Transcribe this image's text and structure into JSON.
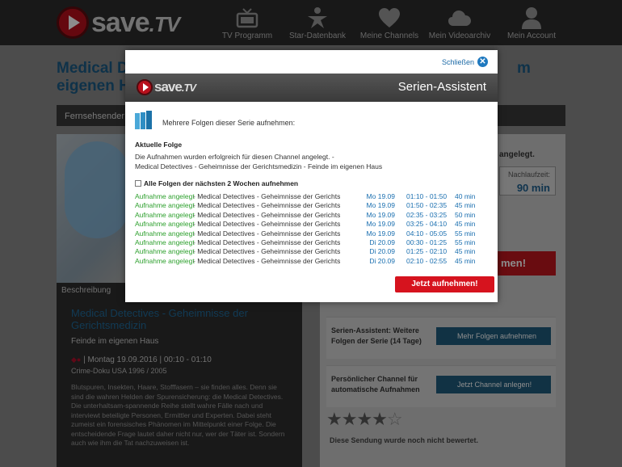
{
  "nav": {
    "logo_text": "save",
    "logo_suffix": ".TV",
    "items": [
      {
        "label": "TV Programm",
        "icon": "tv-icon"
      },
      {
        "label": "Star-Datenbank",
        "icon": "star-person-icon"
      },
      {
        "label": "Meine Channels",
        "icon": "heart-icon"
      },
      {
        "label": "Mein Videoarchiv",
        "icon": "cloud-icon"
      },
      {
        "label": "Mein Account",
        "icon": "user-icon"
      }
    ]
  },
  "background": {
    "title_line1": "Medical D",
    "title_line1_end": "m",
    "title_line2": "eigenen H",
    "sender_select": "Fernsehsender",
    "desc_tab": "Beschreibung",
    "desc_title": "Medical Detectives - Geheimnisse der Gerichtsmedizin",
    "desc_subtitle": "Feinde im eigenen Haus",
    "desc_meta": "| Montag 19.09.2016 | 00:10 - 01:10",
    "desc_genre": "Crime-Doku USA 1996 / 2005",
    "desc_text": "Blutspuren, Insekten, Haare, Stofffasern – sie finden alles. Denn sie sind die wahren Helden der Spurensicherung: die Medical Detectives. Die unterhaltsam-spannende Reihe stellt wahre Fälle nach und interviewt beteiligte Personen, Ermittler und Experten. Dabei steht zumeist ein forensisches Phänomen im Mittelpunkt einer Folge. Die entscheidende Frage lautet daher nicht nur, wer der Täter ist. Sondern auch wie ihm die Tat nachzuweisen ist.",
    "angelegt": "angelegt.",
    "nachlaufzeit_label": "Nachlaufzeit:",
    "nachlaufzeit_value": "90 min",
    "red_button_partial": "men!",
    "serien_text": "Serien-Assistent: Weitere Folgen der Serie (14 Tage)",
    "serien_button": "Mehr Folgen aufnehmen",
    "channel_text": "Persönlicher Channel für automatische Aufnahmen",
    "channel_button": "Jetzt Channel anlegen!",
    "stars_filled": "★★★★",
    "stars_empty": "☆",
    "not_rated": "Diese Sendung wurde noch nicht bewertet."
  },
  "modal": {
    "close_label": "Schließen",
    "header_logo": "save",
    "header_logo_suffix": ".TV",
    "title": "Serien-Assistent",
    "intro": "Mehrere Folgen dieser Serie aufnehmen:",
    "current_heading": "Aktuelle Folge",
    "current_msg_line1": "Die Aufnahmen wurden erfolgreich für diesen Channel angelegt. -",
    "current_msg_line2": "Medical Detectives - Geheimnisse der Gerichtsmedizin - Feinde im eigenen Haus",
    "all_checkbox_label": "Alle Folgen der nächsten 2 Wochen aufnehmen",
    "submit_label": "Jetzt aufnehmen!",
    "colors": {
      "status_green": "#2ea02e",
      "link_blue": "#1a6fb0",
      "button_red": "#d6131e"
    },
    "episodes": [
      {
        "status": "Aufnahme angelegt",
        "title": "- Medical Detectives - Geheimnisse der Gerichts...",
        "date": "Mo 19.09",
        "time": "01:10 - 01:50",
        "duration": "40 min"
      },
      {
        "status": "Aufnahme angelegt",
        "title": "- Medical Detectives - Geheimnisse der Gerichts...",
        "date": "Mo 19.09",
        "time": "01:50 - 02:35",
        "duration": "45 min"
      },
      {
        "status": "Aufnahme angelegt",
        "title": "- Medical Detectives - Geheimnisse der Gerichts...",
        "date": "Mo 19.09",
        "time": "02:35 - 03:25",
        "duration": "50 min"
      },
      {
        "status": "Aufnahme angelegt",
        "title": "- Medical Detectives - Geheimnisse der Gerichts...",
        "date": "Mo 19.09",
        "time": "03:25 - 04:10",
        "duration": "45 min"
      },
      {
        "status": "Aufnahme angelegt",
        "title": "- Medical Detectives - Geheimnisse der Gerichts...",
        "date": "Mo 19.09",
        "time": "04:10 - 05:05",
        "duration": "55 min"
      },
      {
        "status": "Aufnahme angelegt",
        "title": "- Medical Detectives - Geheimnisse der Gerichts...",
        "date": "Di 20.09",
        "time": "00:30 - 01:25",
        "duration": "55 min"
      },
      {
        "status": "Aufnahme angelegt",
        "title": "- Medical Detectives - Geheimnisse der Gerichts...",
        "date": "Di 20.09",
        "time": "01:25 - 02:10",
        "duration": "45 min"
      },
      {
        "status": "Aufnahme angelegt",
        "title": "- Medical Detectives - Geheimnisse der Gerichts...",
        "date": "Di 20.09",
        "time": "02:10 - 02:55",
        "duration": "45 min"
      }
    ]
  }
}
